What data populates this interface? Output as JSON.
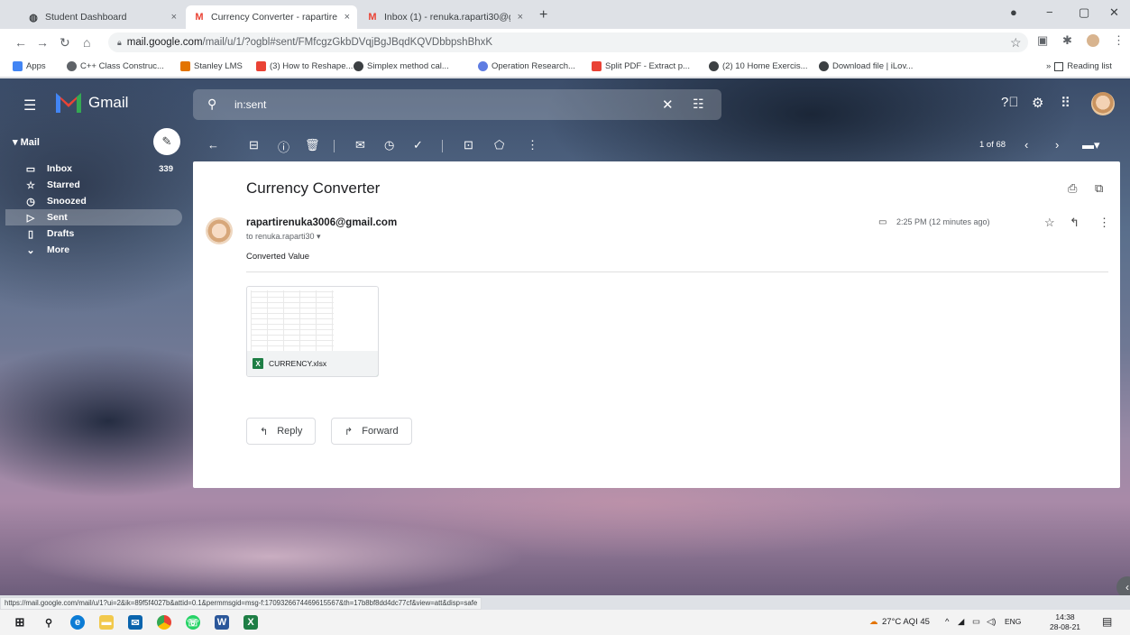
{
  "browser": {
    "tabs": [
      {
        "title": "Student Dashboard",
        "close": "×"
      },
      {
        "title": "Currency Converter - rapartirenu",
        "close": "×"
      },
      {
        "title": "Inbox (1) - renuka.raparti30@gm",
        "close": "×"
      }
    ],
    "new_tab": "+",
    "url_host": "mail.google.com",
    "url_path": "/mail/u/1/?ogbl#sent/FMfcgzGkbDVqjBgJBqdKQVDbbpshBhxK",
    "bookmarks": [
      {
        "label": "Apps",
        "color": "#4285f4"
      },
      {
        "label": "C++ Class Construc...",
        "color": "#5f6368"
      },
      {
        "label": "Stanley LMS",
        "color": "#e37400"
      },
      {
        "label": "(3) How to Reshape...",
        "color": "#ea4335"
      },
      {
        "label": "Simplex method cal...",
        "color": "#3c4043"
      },
      {
        "label": "Operation Research...",
        "color": "#5e7ce2"
      },
      {
        "label": "Split PDF - Extract p...",
        "color": "#e94235"
      },
      {
        "label": "(2) 10 Home Exercis...",
        "color": "#3c4043"
      },
      {
        "label": "Download file | iLov...",
        "color": "#3c4043"
      }
    ],
    "reading_list": "Reading list",
    "status_url": "https://mail.google.com/mail/u/1?ui=2&ik=89f5f4027b&attid=0.1&permmsgid=msg-f:1709326674469615567&th=17b8bf8dd4dc77cf&view=att&disp=safe"
  },
  "gmail": {
    "brand": "Gmail",
    "search_value": "in:sent",
    "mail_label": "Mail",
    "nav": [
      {
        "label": "Inbox",
        "count": "339",
        "icon": "inbox-icon"
      },
      {
        "label": "Starred",
        "count": "",
        "icon": "star-icon"
      },
      {
        "label": "Snoozed",
        "count": "",
        "icon": "clock-icon"
      },
      {
        "label": "Sent",
        "count": "",
        "icon": "send-icon"
      },
      {
        "label": "Drafts",
        "count": "",
        "icon": "draft-icon"
      },
      {
        "label": "More",
        "count": "",
        "icon": "chevron-down-icon"
      }
    ],
    "pager": "1 of 68",
    "email": {
      "subject": "Currency Converter",
      "sender": "rapartirenuka3006@gmail.com",
      "to": "to renuka.raparti30 ▾",
      "time": "2:25 PM (12 minutes ago)",
      "body": "Converted Value",
      "attachment_name": "CURRENCY.xlsx",
      "reply_label": "Reply",
      "forward_label": "Forward"
    }
  },
  "taskbar": {
    "weather": "27°C AQI 45",
    "lang": "ENG",
    "time": "14:38",
    "date": "28-08-21"
  }
}
